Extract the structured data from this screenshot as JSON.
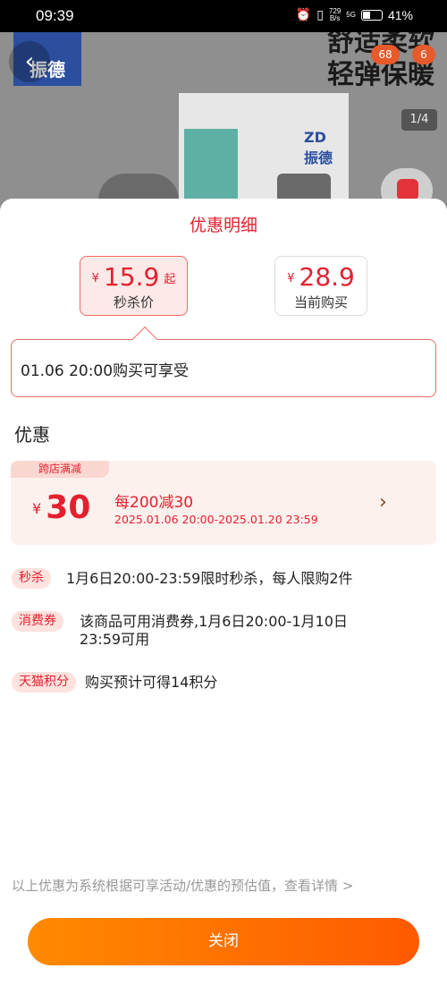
{
  "status_bar": {
    "time": "09:39",
    "network_speed": "729",
    "network_unit": "B/s",
    "signal": "5G",
    "battery_percent": "41%"
  },
  "backdrop": {
    "logo_letters": "ZD",
    "logo_name": "振德",
    "slogan_line1": "舒适柔软",
    "slogan_line2": "轻弹保暖",
    "badge_left": "68",
    "badge_right": "6",
    "page_indicator": "1/4"
  },
  "sheet": {
    "title": "优惠明细",
    "flash_card": {
      "currency": "¥",
      "price": "15.9",
      "suffix": "起",
      "label": "秒杀价"
    },
    "current_card": {
      "currency": "¥",
      "price": "28.9",
      "label": "当前购买"
    },
    "tip_text": "01.06 20:00购买可享受",
    "section_title": "优惠",
    "coupon": {
      "tag": "跨店满减",
      "currency": "¥",
      "amount": "30",
      "rule": "每200减30",
      "date_range": "2025.01.06 20:00-2025.01.20 23:59"
    },
    "promos": [
      {
        "tag": "秒杀",
        "text": "1月6日20:00-23:59限时秒杀，每人限购2件"
      },
      {
        "tag": "消费券",
        "text_line1": "该商品可用消费券,1月6日20:00-1月10日",
        "text_line2": "23:59可用"
      },
      {
        "tag": "天猫积分",
        "text": "购买预计可得14积分"
      }
    ],
    "footer_note": "以上优惠为系统根据可享活动/优惠的预估值，查看详情 >",
    "close_label": "关闭"
  },
  "colors": {
    "accent_red": "#e4202f",
    "button_gradient_start": "#ff8a00",
    "button_gradient_end": "#ff5a00",
    "coupon_bg": "#fdf1ee"
  }
}
